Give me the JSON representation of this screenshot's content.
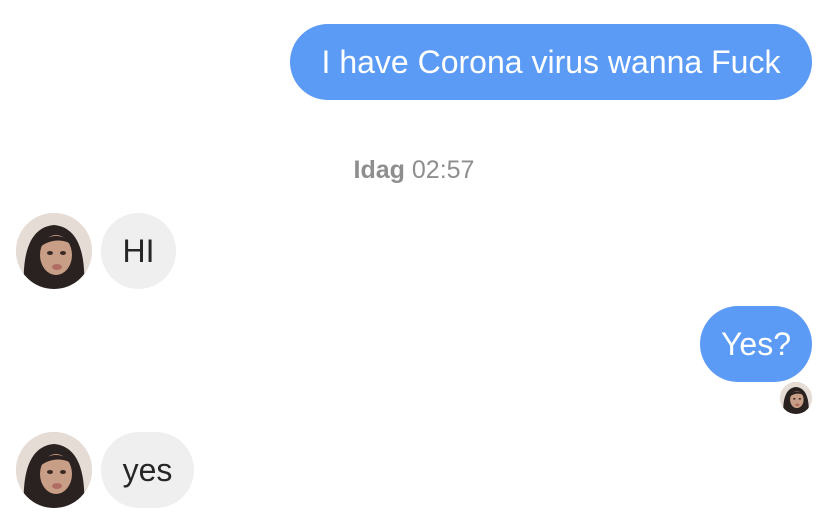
{
  "messages": [
    {
      "direction": "outgoing",
      "text": "I have Corona virus wanna Fuck"
    },
    {
      "direction": "incoming",
      "text": "HI"
    },
    {
      "direction": "outgoing",
      "text": "Yes?"
    },
    {
      "direction": "incoming",
      "text": "yes"
    }
  ],
  "timestamp": {
    "day": "Idag",
    "time": "02:57"
  },
  "colors": {
    "outgoing_bubble": "#5b9bf5",
    "incoming_bubble": "#efefef",
    "incoming_text": "#262626",
    "timestamp_text": "#8e8e8e"
  },
  "icons": {
    "avatar": "profile-photo-avatar",
    "seen": "seen-avatar-icon"
  }
}
